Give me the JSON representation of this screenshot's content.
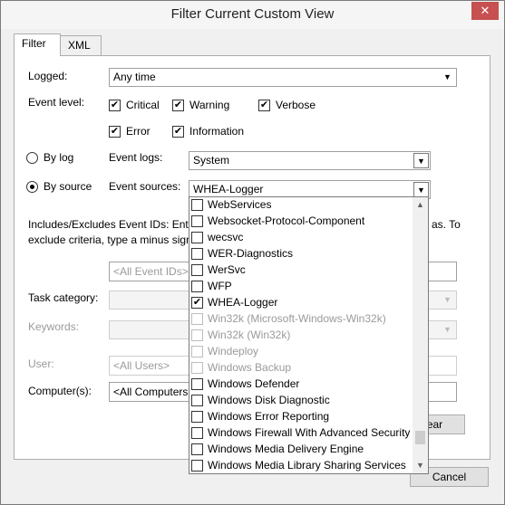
{
  "window": {
    "title": "Filter Current Custom View",
    "close_glyph": "✕"
  },
  "tabs": [
    {
      "label": "Filter"
    },
    {
      "label": "XML"
    }
  ],
  "filter": {
    "logged_label": "Logged:",
    "logged_value": "Any time",
    "event_level_label": "Event level:",
    "levels": {
      "critical": {
        "label": "Critical",
        "checked": true
      },
      "warning": {
        "label": "Warning",
        "checked": true
      },
      "verbose": {
        "label": "Verbose",
        "checked": true
      },
      "error": {
        "label": "Error",
        "checked": true
      },
      "information": {
        "label": "Information",
        "checked": true
      }
    },
    "by_log_label": "By log",
    "by_source_label": "By source",
    "event_logs_label": "Event logs:",
    "event_logs_value": "System",
    "event_sources_label": "Event sources:",
    "event_sources_value": "WHEA-Logger",
    "includes_text_1": "Includes/Excludes Event IDs: Enter",
    "includes_text_1b": "as. To",
    "includes_text_2": "exclude criteria, type a minus sign",
    "event_ids_placeholder": "<All Event IDs>",
    "task_category_label": "Task category:",
    "keywords_label": "Keywords:",
    "user_label": "User:",
    "user_placeholder": "<All Users>",
    "computers_label": "Computer(s):",
    "computers_value": "<All Computers",
    "clear_label": "ear",
    "cancel_label": "Cancel"
  },
  "source_list": [
    {
      "label": "WebServices",
      "checked": false,
      "dim": false
    },
    {
      "label": "Websocket-Protocol-Component",
      "checked": false,
      "dim": false
    },
    {
      "label": "wecsvc",
      "checked": false,
      "dim": false
    },
    {
      "label": "WER-Diagnostics",
      "checked": false,
      "dim": false
    },
    {
      "label": "WerSvc",
      "checked": false,
      "dim": false
    },
    {
      "label": "WFP",
      "checked": false,
      "dim": false
    },
    {
      "label": "WHEA-Logger",
      "checked": true,
      "dim": false
    },
    {
      "label": "Win32k (Microsoft-Windows-Win32k)",
      "checked": false,
      "dim": true
    },
    {
      "label": "Win32k (Win32k)",
      "checked": false,
      "dim": true
    },
    {
      "label": "Windeploy",
      "checked": false,
      "dim": true
    },
    {
      "label": "Windows Backup",
      "checked": false,
      "dim": true
    },
    {
      "label": "Windows Defender",
      "checked": false,
      "dim": false
    },
    {
      "label": "Windows Disk Diagnostic",
      "checked": false,
      "dim": false
    },
    {
      "label": "Windows Error Reporting",
      "checked": false,
      "dim": false
    },
    {
      "label": "Windows Firewall With Advanced Security",
      "checked": false,
      "dim": false
    },
    {
      "label": "Windows Media Delivery Engine",
      "checked": false,
      "dim": false
    },
    {
      "label": "Windows Media Library Sharing Services",
      "checked": false,
      "dim": false
    }
  ],
  "icons": {
    "dropdown": "chevron-down-icon",
    "check": "checkmark-icon",
    "close": "close-icon"
  },
  "glyphs": {
    "down": "▼",
    "up": "▲",
    "check": "✔"
  }
}
